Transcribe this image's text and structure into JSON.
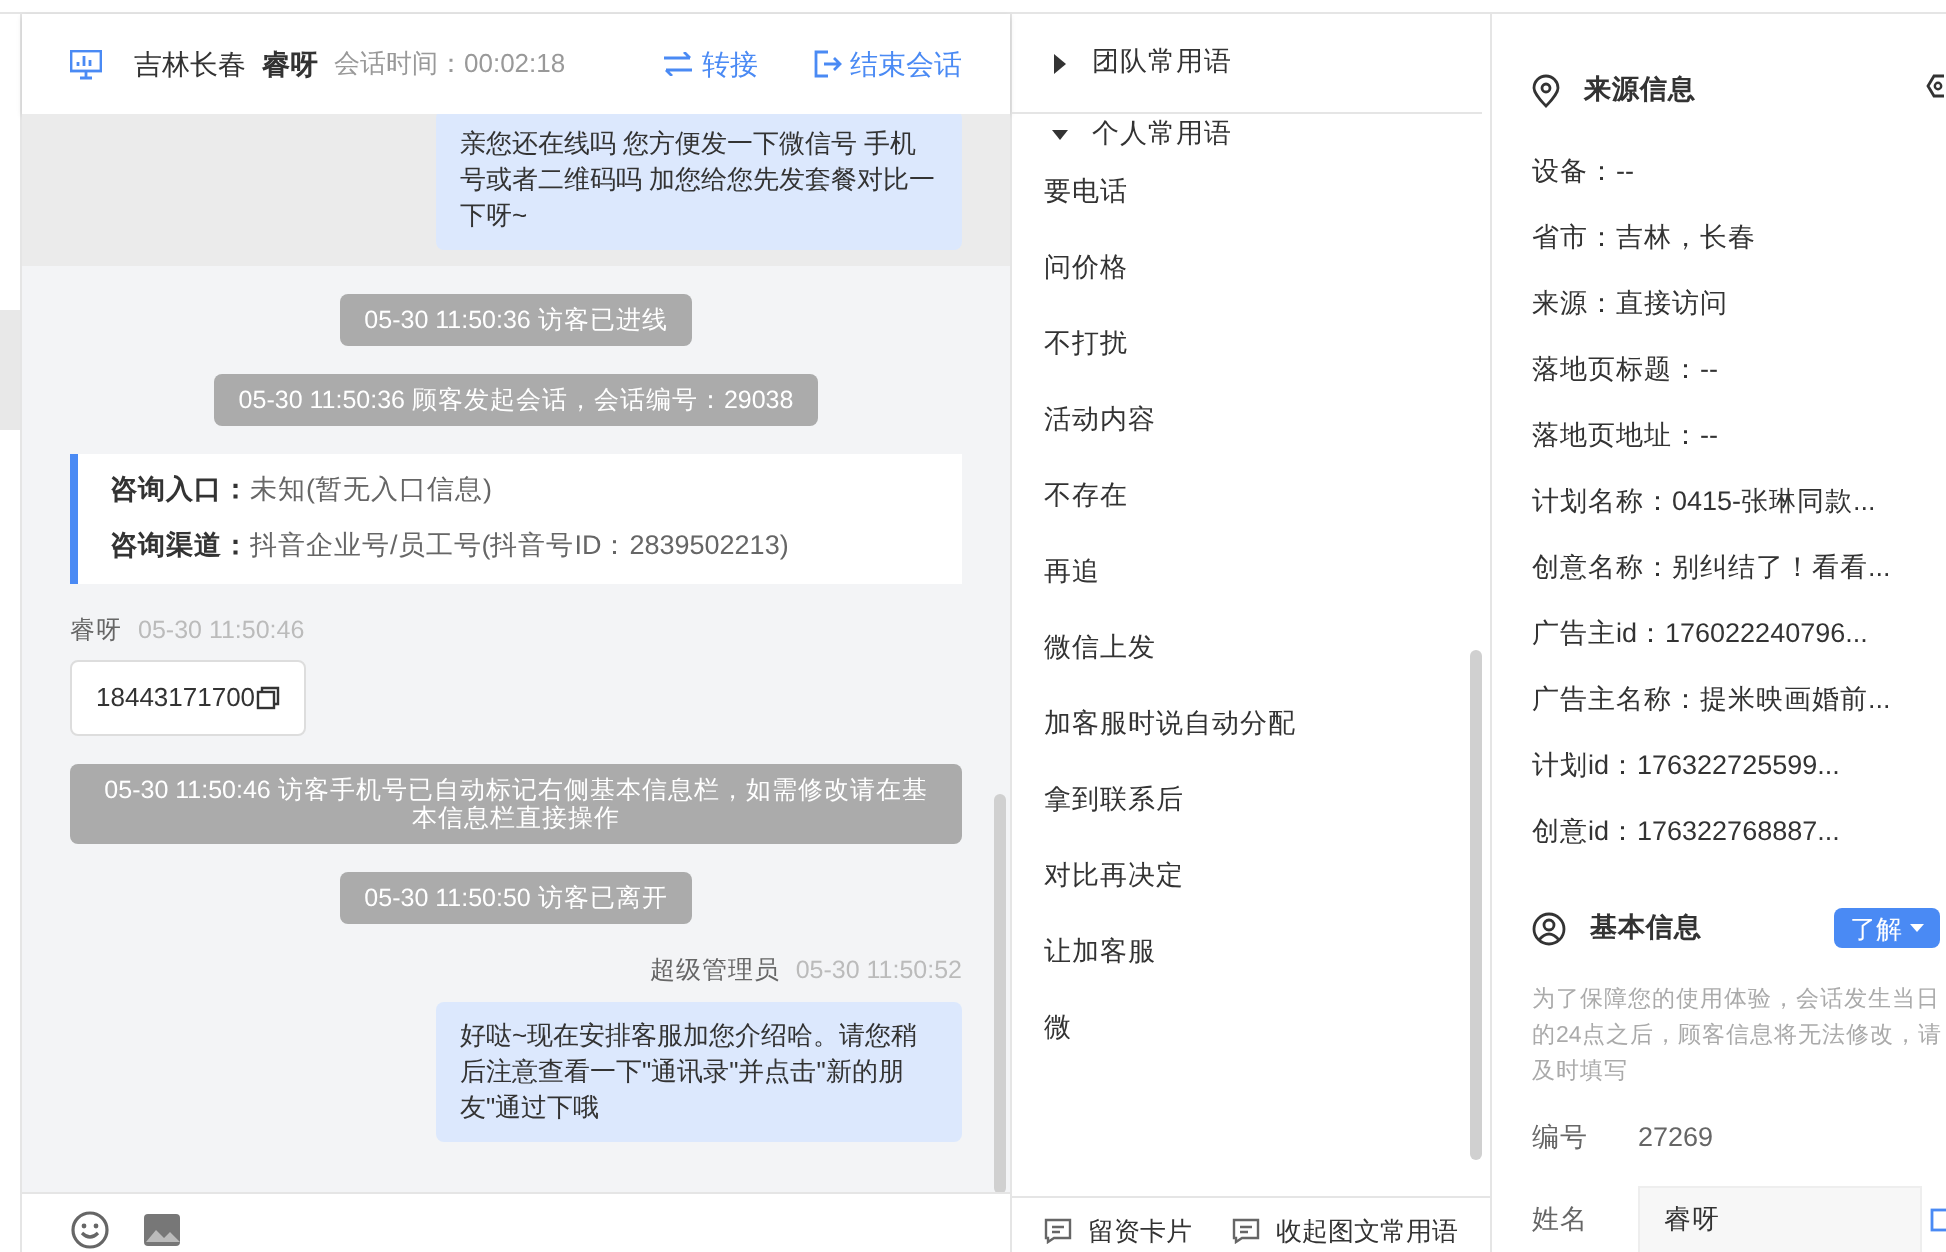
{
  "header": {
    "location": "吉林长春",
    "visitor": "睿呀",
    "duration_label": "会话时间：",
    "duration": "00:02:18",
    "actions": [
      {
        "kind": "transfer",
        "label": "转接"
      },
      {
        "kind": "end",
        "label": "结束会话"
      }
    ]
  },
  "messages": [
    {
      "kind": "agent",
      "text": "亲您还在线吗 您方便发一下微信号 手机号或者二维码吗 加您给您先发套餐对比一下呀~",
      "highlighted": true
    },
    {
      "kind": "system",
      "text": "05-30 11:50:36 访客已进线"
    },
    {
      "kind": "system",
      "text": "05-30 11:50:36 顾客发起会话，会话编号：29038"
    },
    {
      "kind": "info",
      "rows": [
        {
          "label": "咨询入口：",
          "value": "未知(暂无入口信息)"
        },
        {
          "label": "咨询渠道：",
          "value": "抖音企业号/员工号(抖音号ID：2839502213)"
        }
      ]
    },
    {
      "kind": "visitor",
      "sender": "睿呀",
      "time": "05-30 11:50:46",
      "text": "18443171700"
    },
    {
      "kind": "system",
      "text": "05-30 11:50:46 访客手机号已自动标记右侧基本信息栏，如需修改请在基本信息栏直接操作"
    },
    {
      "kind": "system",
      "text": "05-30 11:50:50 访客已离开"
    },
    {
      "kind": "agent",
      "sender": "超级管理员",
      "time": "05-30 11:50:52",
      "text": "好哒~现在安排客服加您介绍哈。请您稍后注意查看一下\"通讯录\"并点击\"新的朋友\"通过下哦",
      "highlighted": false
    }
  ],
  "phrases": {
    "groups": [
      {
        "label": "团队常用语",
        "expanded": false
      },
      {
        "label": "个人常用语",
        "expanded": true
      }
    ],
    "items": [
      "要电话",
      "问价格",
      "不打扰",
      "活动内容",
      "不存在",
      "再追",
      "微信上发",
      "加客服时说自动分配",
      "拿到联系后",
      "对比再决定",
      "让加客服",
      "微"
    ],
    "footer": [
      "留资卡片",
      "收起图文常用语"
    ]
  },
  "source_info": {
    "title": "来源信息",
    "rows": [
      "设备：--",
      "省市：吉林，长春",
      "来源：直接访问",
      "落地页标题：--",
      "落地页地址：--",
      "计划名称：0415-张琳同款...",
      "创意名称：别纠结了！看看...",
      "广告主id：176022240796...",
      "广告主名称：提米映画婚前...",
      "计划id：176322725599...",
      "创意id：176322768887..."
    ]
  },
  "basic_info": {
    "title": "基本信息",
    "button": "了解",
    "notice": "为了保障您的使用体验，会话发生当日的24点之后，顾客信息将无法修改，请及时填写",
    "fields": [
      {
        "label": "编号",
        "value": "27269",
        "editable": false
      },
      {
        "label": "姓名",
        "value": "睿呀",
        "editable": true
      }
    ]
  }
}
